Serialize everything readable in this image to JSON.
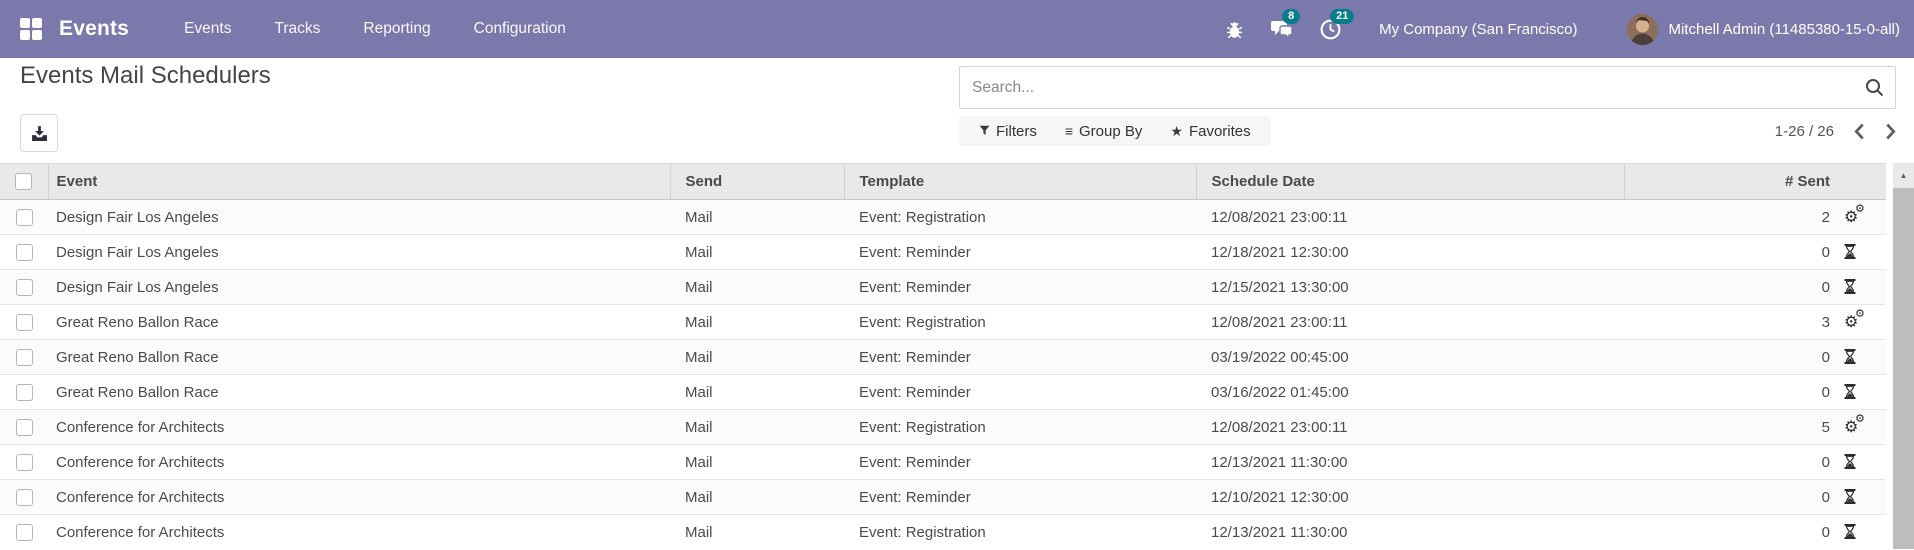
{
  "navbar": {
    "brand": "Events",
    "menus": [
      {
        "label": "Events"
      },
      {
        "label": "Tracks"
      },
      {
        "label": "Reporting"
      },
      {
        "label": "Configuration"
      }
    ],
    "systray": {
      "messages_badge": "8",
      "activities_badge": "21",
      "company": "My Company (San Francisco)",
      "user": "Mitchell Admin (11485380-15-0-all)"
    },
    "bar_color": "#7b79ac",
    "badge_color": "#0a7d8c"
  },
  "control_panel": {
    "title": "Events Mail Schedulers",
    "search_placeholder": "Search...",
    "filters_label": "Filters",
    "group_by_label": "Group By",
    "favorites_label": "Favorites",
    "pager": "1-26 / 26"
  },
  "table": {
    "columns": [
      "Event",
      "Send",
      "Template",
      "Schedule Date",
      "# Sent"
    ],
    "rows": [
      {
        "event": "Design Fair Los Angeles",
        "send": "Mail",
        "template": "Event: Registration",
        "schedule_date": "12/08/2021 23:00:11",
        "sent": "2",
        "state_icon": "cogs-icon"
      },
      {
        "event": "Design Fair Los Angeles",
        "send": "Mail",
        "template": "Event: Reminder",
        "schedule_date": "12/18/2021 12:30:00",
        "sent": "0",
        "state_icon": "hourglass-icon"
      },
      {
        "event": "Design Fair Los Angeles",
        "send": "Mail",
        "template": "Event: Reminder",
        "schedule_date": "12/15/2021 13:30:00",
        "sent": "0",
        "state_icon": "hourglass-icon"
      },
      {
        "event": "Great Reno Ballon Race",
        "send": "Mail",
        "template": "Event: Registration",
        "schedule_date": "12/08/2021 23:00:11",
        "sent": "3",
        "state_icon": "cogs-icon"
      },
      {
        "event": "Great Reno Ballon Race",
        "send": "Mail",
        "template": "Event: Reminder",
        "schedule_date": "03/19/2022 00:45:00",
        "sent": "0",
        "state_icon": "hourglass-icon"
      },
      {
        "event": "Great Reno Ballon Race",
        "send": "Mail",
        "template": "Event: Reminder",
        "schedule_date": "03/16/2022 01:45:00",
        "sent": "0",
        "state_icon": "hourglass-icon"
      },
      {
        "event": "Conference for Architects",
        "send": "Mail",
        "template": "Event: Registration",
        "schedule_date": "12/08/2021 23:00:11",
        "sent": "5",
        "state_icon": "cogs-icon"
      },
      {
        "event": "Conference for Architects",
        "send": "Mail",
        "template": "Event: Reminder",
        "schedule_date": "12/13/2021 11:30:00",
        "sent": "0",
        "state_icon": "hourglass-icon"
      },
      {
        "event": "Conference for Architects",
        "send": "Mail",
        "template": "Event: Reminder",
        "schedule_date": "12/10/2021 12:30:00",
        "sent": "0",
        "state_icon": "hourglass-icon"
      },
      {
        "event": "Conference for Architects",
        "send": "Mail",
        "template": "Event: Registration",
        "schedule_date": "12/13/2021 11:30:00",
        "sent": "0",
        "state_icon": "hourglass-icon"
      }
    ]
  }
}
